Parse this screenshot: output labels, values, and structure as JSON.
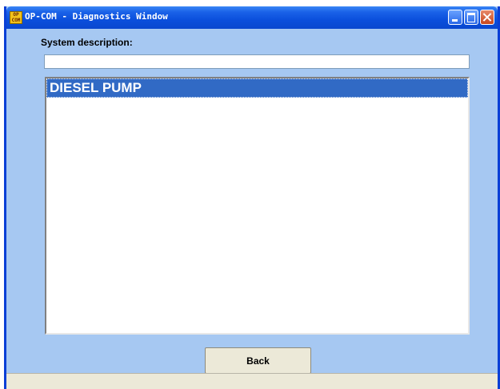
{
  "window": {
    "title": "OP-COM - Diagnostics Window",
    "icon_text": "OP COM",
    "icon": "op-com-app-icon",
    "controls": [
      "minimize-icon",
      "maximize-icon",
      "close-icon"
    ]
  },
  "system_description": {
    "label": "System description:",
    "value": ""
  },
  "systems_list": {
    "items": [
      {
        "label": "DIESEL PUMP",
        "selected": true
      }
    ]
  },
  "buttons": {
    "back_label": "Back"
  },
  "colors": {
    "titlebar": "#0b4fdc",
    "background": "#a6c8f2",
    "selection": "#316ac5",
    "button_face": "#ece9d8"
  }
}
